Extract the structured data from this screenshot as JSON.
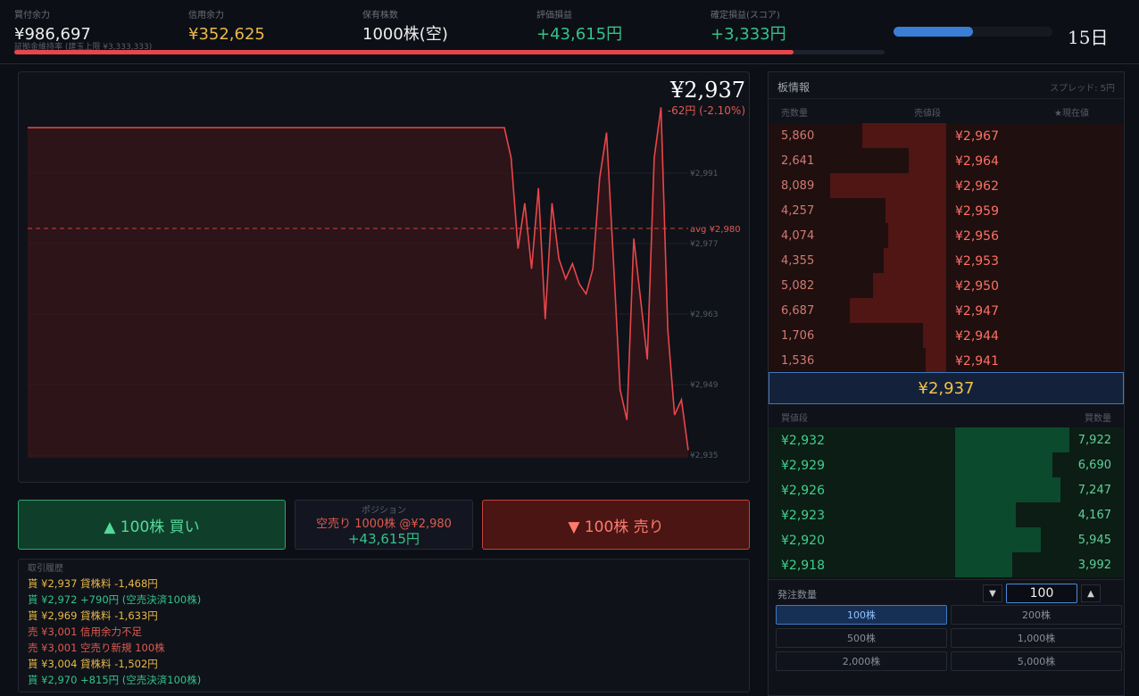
{
  "stats": {
    "cash": {
      "label": "買付余力",
      "value": "¥986,697"
    },
    "credit": {
      "label": "信用余力",
      "value": "¥352,625"
    },
    "holdings": {
      "label": "保有株数",
      "value": "1000株(空)"
    },
    "unrealized": {
      "label": "評価損益",
      "value": "+43,615円"
    },
    "realized": {
      "label": "確定損益(スコア)",
      "value": "+3,333円"
    },
    "margin_note": "証拠金維持率 (建玉上限 ¥3,333,333)",
    "risk_fill": 0.895
  },
  "day": {
    "label": "15日",
    "progress": 0.5
  },
  "chart": {
    "current_price": "¥2,937",
    "change": "-62円 (-2.10%)",
    "avg_label": "avg ¥2,980",
    "avg_value": 2980,
    "y_ticks": [
      "¥2,991",
      "¥2,977",
      "¥2,963",
      "¥2,949",
      "¥2,935"
    ],
    "y_tick_values": [
      2991,
      2977,
      2963,
      2949,
      2935
    ],
    "line_color": "#e8464a",
    "prices": [
      3000,
      3000,
      3000,
      3000,
      3000,
      3000,
      3000,
      3000,
      3000,
      3000,
      3000,
      3000,
      3000,
      3000,
      3000,
      3000,
      3000,
      3000,
      3000,
      3000,
      3000,
      3000,
      3000,
      3000,
      3000,
      3000,
      3000,
      3000,
      3000,
      3000,
      3000,
      3000,
      3000,
      3000,
      3000,
      3000,
      3000,
      3000,
      3000,
      3000,
      3000,
      3000,
      3000,
      3000,
      3000,
      3000,
      3000,
      3000,
      3000,
      3000,
      3000,
      3000,
      3000,
      3000,
      3000,
      3000,
      3000,
      3000,
      3000,
      3000,
      3000,
      3000,
      3000,
      3000,
      3000,
      3000,
      3000,
      3000,
      3000,
      3000,
      3000,
      2994,
      2976,
      2985,
      2972,
      2988,
      2962,
      2985,
      2974,
      2970,
      2973,
      2969,
      2967,
      2972,
      2990,
      2999,
      2974,
      2948,
      2942,
      2978,
      2966,
      2954,
      2994,
      3004,
      2960,
      2943,
      2946,
      2936
    ]
  },
  "actions": {
    "buy_label": "▲ 100株 買い",
    "sell_label": "▼ 100株 売り",
    "position_title": "ポジション",
    "position_detail": "空売り 1000株 @¥2,980",
    "position_pnl": "+43,615円"
  },
  "history": {
    "title": "取引履歴",
    "rows": [
      {
        "side": "貰",
        "text": "¥2,937 貸株料 -1,468円",
        "color": "#e9b949"
      },
      {
        "side": "貰",
        "text": "¥2,972 +790円 (空売決済100株)",
        "color": "#33c38a"
      },
      {
        "side": "貰",
        "text": "¥2,969 貸株料 -1,633円",
        "color": "#e9b949"
      },
      {
        "side": "売",
        "text": "¥3,001 信用余力不足",
        "color": "#e05a50"
      },
      {
        "side": "売",
        "text": "¥3,001 空売り新規 100株",
        "color": "#e05a50"
      },
      {
        "side": "貰",
        "text": "¥3,004 貸株料 -1,502円",
        "color": "#e9b949"
      },
      {
        "side": "貰",
        "text": "¥2,970 +815円 (空売決済100株)",
        "color": "#33c38a"
      }
    ]
  },
  "book": {
    "title": "板情報",
    "spread": "スプレッド: 5円",
    "col_ask_qty": "売数量",
    "col_ask_price": "売値段",
    "col_marker": "★現在値",
    "col_bid_price": "買値段",
    "col_bid_qty": "買数量",
    "asks": [
      {
        "qty": "5,860",
        "price": "¥2,967",
        "depth": 0.72
      },
      {
        "qty": "2,641",
        "price": "¥2,964",
        "depth": 0.32
      },
      {
        "qty": "8,089",
        "price": "¥2,962",
        "depth": 1.0
      },
      {
        "qty": "4,257",
        "price": "¥2,959",
        "depth": 0.52
      },
      {
        "qty": "4,074",
        "price": "¥2,956",
        "depth": 0.5
      },
      {
        "qty": "4,355",
        "price": "¥2,953",
        "depth": 0.54
      },
      {
        "qty": "5,082",
        "price": "¥2,950",
        "depth": 0.63
      },
      {
        "qty": "6,687",
        "price": "¥2,947",
        "depth": 0.83
      },
      {
        "qty": "1,706",
        "price": "¥2,944",
        "depth": 0.2
      },
      {
        "qty": "1,536",
        "price": "¥2,941",
        "depth": 0.18
      }
    ],
    "mid_price": "¥2,937",
    "bids": [
      {
        "price": "¥2,932",
        "qty": "7,922",
        "depth": 1.0
      },
      {
        "price": "¥2,929",
        "qty": "6,690",
        "depth": 0.85
      },
      {
        "price": "¥2,926",
        "qty": "7,247",
        "depth": 0.92
      },
      {
        "price": "¥2,923",
        "qty": "4,167",
        "depth": 0.53
      },
      {
        "price": "¥2,920",
        "qty": "5,945",
        "depth": 0.75
      },
      {
        "price": "¥2,918",
        "qty": "3,992",
        "depth": 0.5
      }
    ]
  },
  "order": {
    "label": "発注数量",
    "qty_value": "100",
    "down_glyph": "▼",
    "up_glyph": "▲",
    "presets": [
      "100株",
      "200株",
      "500株",
      "1,000株",
      "2,000株",
      "5,000株"
    ],
    "active_preset": 0
  }
}
